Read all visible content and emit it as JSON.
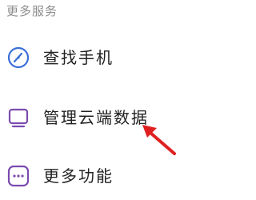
{
  "section": {
    "title": "更多服务"
  },
  "items": [
    {
      "label": "查找手机",
      "icon": "compass-icon"
    },
    {
      "label": "管理云端数据",
      "icon": "monitor-icon"
    },
    {
      "label": "更多功能",
      "icon": "more-dots-icon"
    }
  ],
  "colors": {
    "section_title": "#8c8c8c",
    "label": "#222222",
    "find_icon": "#3b6fd8",
    "cloud_icon": "#7b4bb0",
    "more_icon": "#7b4bb0",
    "arrow": "#e02020"
  }
}
